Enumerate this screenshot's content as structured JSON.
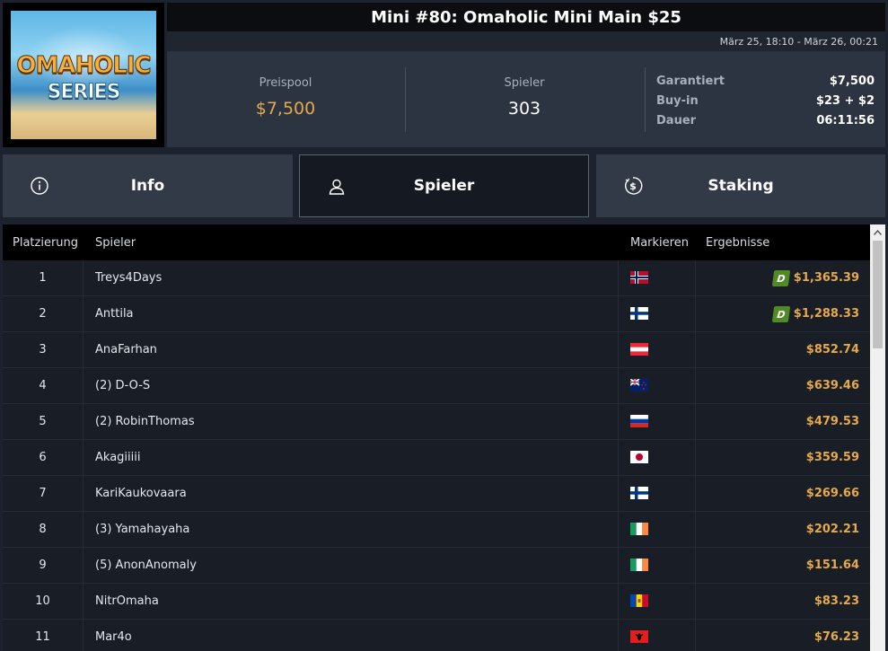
{
  "logo": {
    "line1": "OMAHOLIC",
    "line2": "SERIES"
  },
  "header": {
    "title": "Mini #80: Omaholic Mini Main $25",
    "date_range": "März 25, 18:10 - März 26, 00:21"
  },
  "stats": {
    "prize_pool_label": "Preispool",
    "prize_pool_value": "$7,500",
    "players_label": "Spieler",
    "players_value": "303",
    "details": [
      {
        "label": "Garantiert",
        "value": "$7,500"
      },
      {
        "label": "Buy-in",
        "value": "$23 + $2"
      },
      {
        "label": "Dauer",
        "value": "06:11:56"
      }
    ]
  },
  "tabs": [
    {
      "label": "Info",
      "icon": "info-icon",
      "active": false
    },
    {
      "label": "Spieler",
      "icon": "user-icon",
      "active": true
    },
    {
      "label": "Staking",
      "icon": "dollar-cycle-icon",
      "active": false
    }
  ],
  "table": {
    "headers": {
      "rank": "Platzierung",
      "player": "Spieler",
      "flag": "Markieren",
      "result": "Ergebnisse"
    },
    "badge_letter": "D",
    "rows": [
      {
        "rank": "1",
        "player": "Treys4Days",
        "country": "norway",
        "result": "$1,365.39",
        "badge": true
      },
      {
        "rank": "2",
        "player": "Anttila",
        "country": "finland",
        "result": "$1,288.33",
        "badge": true
      },
      {
        "rank": "3",
        "player": "AnaFarhan",
        "country": "austria",
        "result": "$852.74",
        "badge": false
      },
      {
        "rank": "4",
        "player": "(2) D-O-S",
        "country": "new-zealand",
        "result": "$639.46",
        "badge": false
      },
      {
        "rank": "5",
        "player": "(2) RobinThomas",
        "country": "russia",
        "result": "$479.53",
        "badge": false
      },
      {
        "rank": "6",
        "player": "Akagiiiii",
        "country": "japan",
        "result": "$359.59",
        "badge": false
      },
      {
        "rank": "7",
        "player": "KariKaukovaara",
        "country": "finland",
        "result": "$269.66",
        "badge": false
      },
      {
        "rank": "8",
        "player": "(3) Yamahayaha",
        "country": "ireland",
        "result": "$202.21",
        "badge": false
      },
      {
        "rank": "9",
        "player": "(5) AnonAnomaly",
        "country": "ireland",
        "result": "$151.64",
        "badge": false
      },
      {
        "rank": "10",
        "player": "NitrOmaha",
        "country": "moldova",
        "result": "$83.23",
        "badge": false
      },
      {
        "rank": "11",
        "player": "Mar4o",
        "country": "albania",
        "result": "$76.23",
        "badge": false
      }
    ]
  },
  "colors": {
    "accent": "#e6a94a",
    "badge": "#4f8a24",
    "panel": "#2b3440"
  }
}
